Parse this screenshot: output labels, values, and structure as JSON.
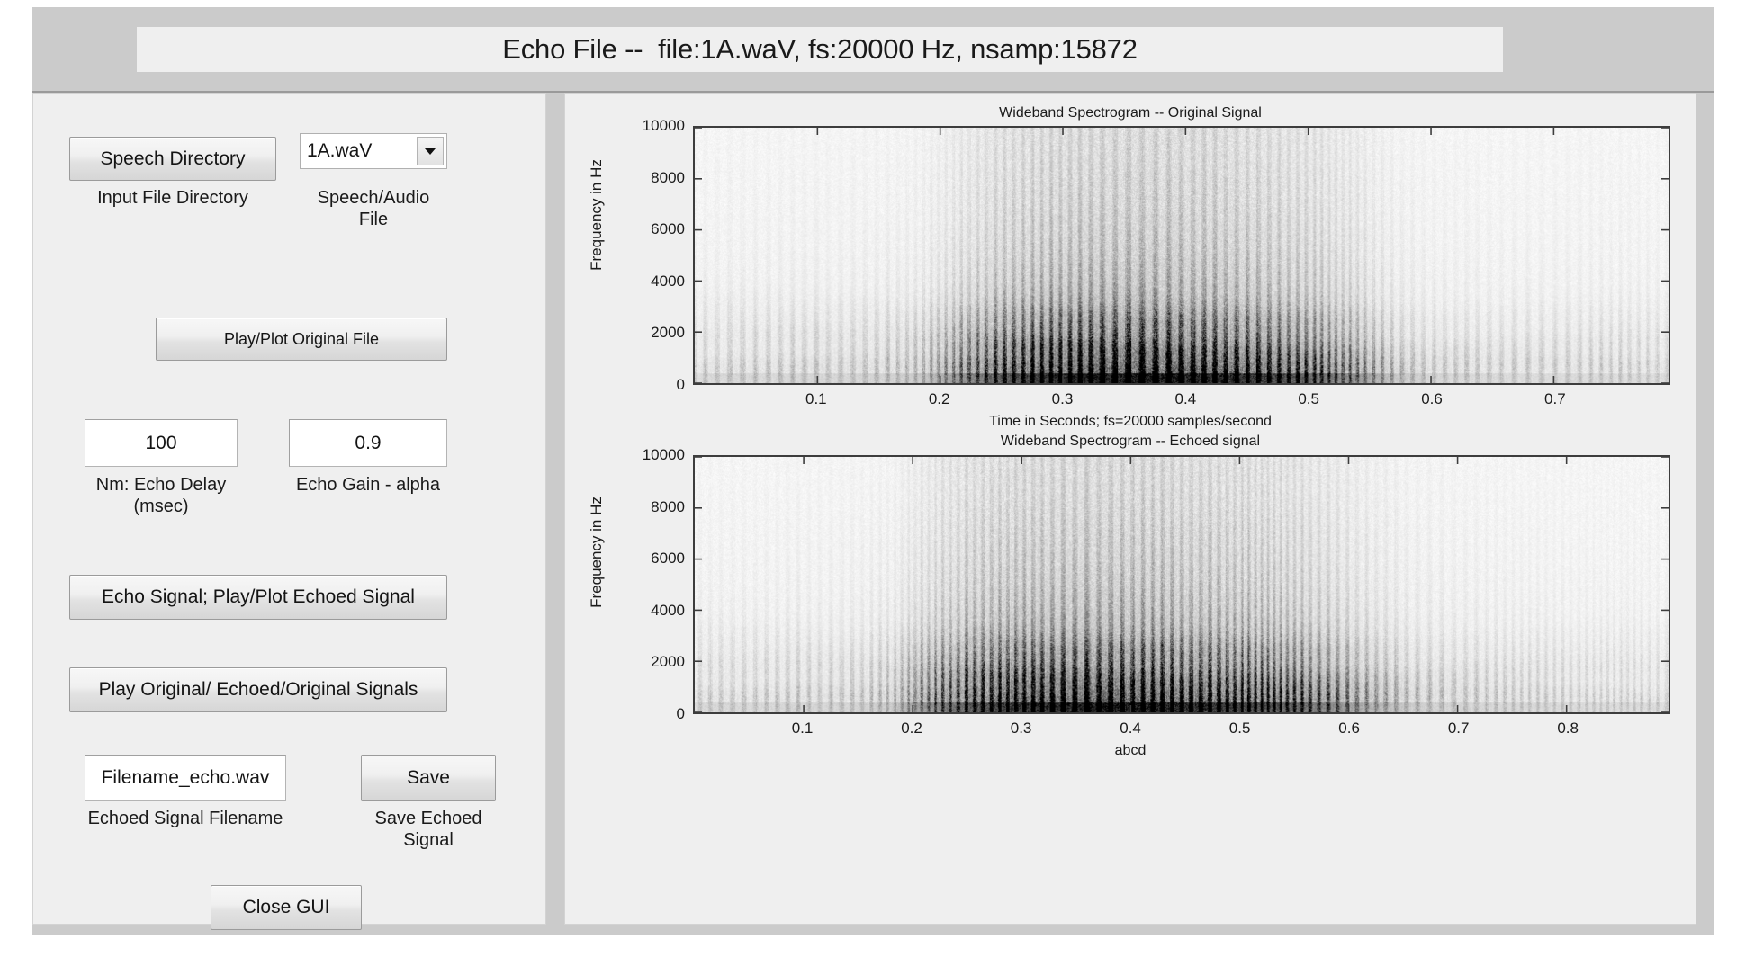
{
  "window": {
    "title": "Echo File --  file:1A.waV, fs:20000 Hz, nsamp:15872",
    "background_color": "#cccccc",
    "panel_color": "#efefef"
  },
  "controls": {
    "speech_directory_button": "Speech Directory",
    "speech_directory_caption": "Input File Directory",
    "audio_file_popup": {
      "selected": "1A.waV",
      "options": [
        "1A.waV"
      ],
      "arrow_icon": "chevron-down-icon"
    },
    "audio_file_caption": "Speech/Audio\nFile",
    "play_plot_original_button": "Play/Plot Original File",
    "echo_delay_field": {
      "value": "100",
      "caption": "Nm: Echo Delay\n(msec)"
    },
    "echo_gain_field": {
      "value": "0.9",
      "caption": "Echo Gain - alpha"
    },
    "echo_signal_button": "Echo Signal; Play/Plot Echoed Signal",
    "play_all_button": "Play Original/ Echoed/Original Signals",
    "filename_field": {
      "value": "Filename_echo.wav",
      "caption": "Echoed Signal Filename"
    },
    "save_button": "Save",
    "save_caption": "Save Echoed\nSignal",
    "close_button": "Close GUI"
  },
  "chart_data": [
    {
      "type": "heatmap",
      "id": "original-spectrogram",
      "title": "Wideband Spectrogram -- Original Signal",
      "xlabel": "Time in Seconds; fs=20000 samples/second",
      "ylabel": "Frequency in Hz",
      "xlim": [
        0,
        0.7936
      ],
      "ylim": [
        0,
        10000
      ],
      "xticks": [
        0.1,
        0.2,
        0.3,
        0.4,
        0.5,
        0.6,
        0.7
      ],
      "xticklabels": [
        "0.1",
        "0.2",
        "0.3",
        "0.4",
        "0.5",
        "0.6",
        "0.7"
      ],
      "yticks": [
        0,
        2000,
        4000,
        6000,
        8000,
        10000
      ],
      "yticklabels": [
        "0",
        "2000",
        "4000",
        "6000",
        "8000",
        "10000"
      ],
      "grid": false,
      "colormap": "gray-inverted",
      "description": "Wideband spectrogram of the original speech waveform; vertical striations from glottal pulses, energy concentrated below 2000 Hz, voiced region roughly 0.20-0.55 s.",
      "envelope": {
        "comment": "Energy envelope vs time in seconds (0 = silence, 1 = peak)",
        "t": [
          0.0,
          0.03,
          0.06,
          0.09,
          0.12,
          0.15,
          0.18,
          0.21,
          0.24,
          0.27,
          0.3,
          0.33,
          0.36,
          0.39,
          0.42,
          0.45,
          0.48,
          0.51,
          0.54,
          0.57,
          0.6,
          0.64,
          0.68,
          0.72,
          0.76,
          0.79
        ],
        "v": [
          0.1,
          0.12,
          0.11,
          0.13,
          0.12,
          0.14,
          0.16,
          0.34,
          0.62,
          0.82,
          0.92,
          0.96,
          1.0,
          0.97,
          0.9,
          0.83,
          0.7,
          0.56,
          0.36,
          0.18,
          0.12,
          0.11,
          0.1,
          0.11,
          0.1,
          0.09
        ]
      },
      "freq_profile": {
        "comment": "Relative darkness vs frequency in Hz (0 = white, 1 = black)",
        "f": [
          0,
          500,
          1000,
          1500,
          2000,
          3000,
          4000,
          5000,
          6000,
          7000,
          8000,
          9000,
          10000
        ],
        "v": [
          1.0,
          0.96,
          0.86,
          0.7,
          0.52,
          0.36,
          0.28,
          0.22,
          0.18,
          0.15,
          0.13,
          0.11,
          0.1
        ]
      }
    },
    {
      "type": "heatmap",
      "id": "echoed-spectrogram",
      "title": "Wideband Spectrogram -- Echoed signal",
      "xlabel": "abcd",
      "ylabel": "Frequency in Hz",
      "xlim": [
        0,
        0.8936
      ],
      "ylim": [
        0,
        10000
      ],
      "xticks": [
        0.1,
        0.2,
        0.3,
        0.4,
        0.5,
        0.6,
        0.7,
        0.8
      ],
      "xticklabels": [
        "0.1",
        "0.2",
        "0.3",
        "0.4",
        "0.5",
        "0.6",
        "0.7",
        "0.8"
      ],
      "yticks": [
        0,
        2000,
        4000,
        6000,
        8000,
        10000
      ],
      "yticklabels": [
        "0",
        "2000",
        "4000",
        "6000",
        "8000",
        "10000"
      ],
      "grid": false,
      "colormap": "gray-inverted",
      "description": "Wideband spectrogram of the echoed signal (echo delay 100 msec, gain 0.9); same structure as original but smeared and extended about 0.1 s later.",
      "envelope": {
        "comment": "Energy envelope vs time in seconds (0 = silence, 1 = peak)",
        "t": [
          0.0,
          0.03,
          0.06,
          0.09,
          0.12,
          0.15,
          0.18,
          0.21,
          0.24,
          0.27,
          0.3,
          0.34,
          0.38,
          0.42,
          0.46,
          0.5,
          0.54,
          0.58,
          0.62,
          0.66,
          0.7,
          0.74,
          0.78,
          0.82,
          0.86,
          0.89
        ],
        "v": [
          0.1,
          0.12,
          0.11,
          0.13,
          0.12,
          0.14,
          0.17,
          0.38,
          0.62,
          0.78,
          0.88,
          0.96,
          1.0,
          0.95,
          0.88,
          0.8,
          0.66,
          0.46,
          0.26,
          0.16,
          0.13,
          0.12,
          0.11,
          0.1,
          0.1,
          0.09
        ]
      },
      "freq_profile": {
        "comment": "Relative darkness vs frequency in Hz (0 = white, 1 = black)",
        "f": [
          0,
          500,
          1000,
          1500,
          2000,
          3000,
          4000,
          5000,
          6000,
          7000,
          8000,
          9000,
          10000
        ],
        "v": [
          1.0,
          0.96,
          0.87,
          0.72,
          0.54,
          0.38,
          0.3,
          0.23,
          0.19,
          0.16,
          0.13,
          0.11,
          0.1
        ]
      }
    }
  ]
}
